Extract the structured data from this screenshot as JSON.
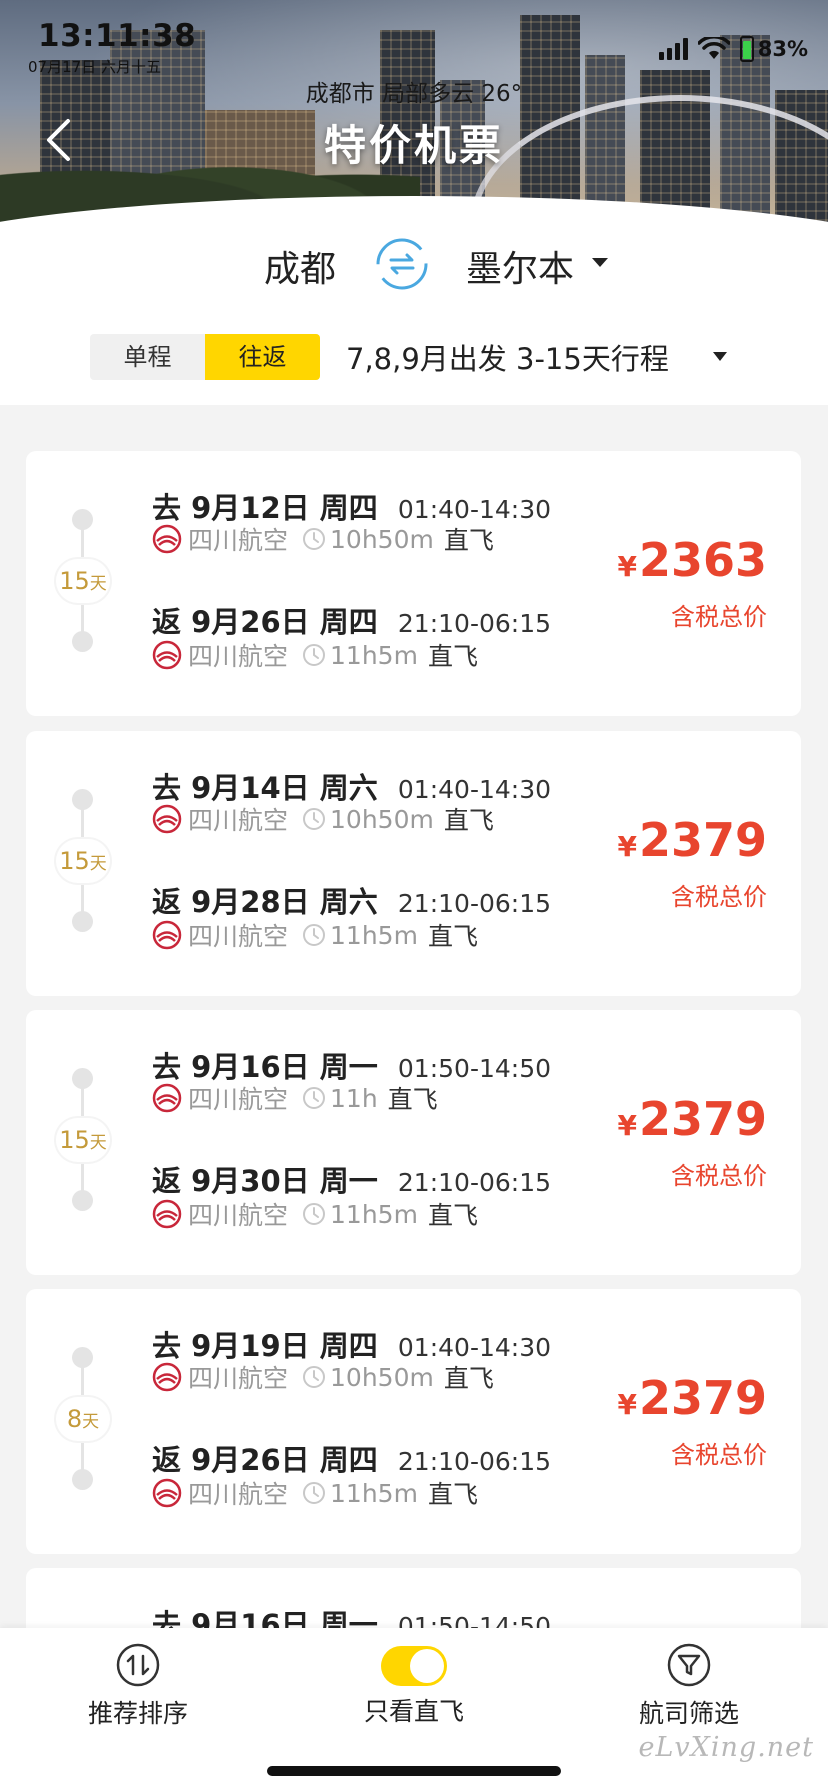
{
  "status_bar": {
    "time": "13:11:38",
    "date": "07月17日 六月十五",
    "battery": "83%"
  },
  "header": {
    "weather": "成都市 局部多云 26°",
    "title": "特价机票"
  },
  "route": {
    "from": "成都",
    "to": "墨尔本"
  },
  "filters": {
    "trip_types": [
      "单程",
      "往返"
    ],
    "active_trip_type": "往返",
    "date_range": "7,8,9月出发 3-15天行程"
  },
  "cards": [
    {
      "days": "15",
      "days_unit": "天",
      "outbound": {
        "dir": "去",
        "date": "9月12日",
        "weekday": "周四",
        "times": "01:40-14:30",
        "airline": "四川航空",
        "duration": "10h50m",
        "type": "直飞"
      },
      "return": {
        "dir": "返",
        "date": "9月26日",
        "weekday": "周四",
        "times": "21:10-06:15",
        "airline": "四川航空",
        "duration": "11h5m",
        "type": "直飞"
      },
      "currency": "¥",
      "price": "2363",
      "price_note": "含税总价"
    },
    {
      "days": "15",
      "days_unit": "天",
      "outbound": {
        "dir": "去",
        "date": "9月14日",
        "weekday": "周六",
        "times": "01:40-14:30",
        "airline": "四川航空",
        "duration": "10h50m",
        "type": "直飞"
      },
      "return": {
        "dir": "返",
        "date": "9月28日",
        "weekday": "周六",
        "times": "21:10-06:15",
        "airline": "四川航空",
        "duration": "11h5m",
        "type": "直飞"
      },
      "currency": "¥",
      "price": "2379",
      "price_note": "含税总价"
    },
    {
      "days": "15",
      "days_unit": "天",
      "outbound": {
        "dir": "去",
        "date": "9月16日",
        "weekday": "周一",
        "times": "01:50-14:50",
        "airline": "四川航空",
        "duration": "11h",
        "type": "直飞"
      },
      "return": {
        "dir": "返",
        "date": "9月30日",
        "weekday": "周一",
        "times": "21:10-06:15",
        "airline": "四川航空",
        "duration": "11h5m",
        "type": "直飞"
      },
      "currency": "¥",
      "price": "2379",
      "price_note": "含税总价"
    },
    {
      "days": "8",
      "days_unit": "天",
      "outbound": {
        "dir": "去",
        "date": "9月19日",
        "weekday": "周四",
        "times": "01:40-14:30",
        "airline": "四川航空",
        "duration": "10h50m",
        "type": "直飞"
      },
      "return": {
        "dir": "返",
        "date": "9月26日",
        "weekday": "周四",
        "times": "21:10-06:15",
        "airline": "四川航空",
        "duration": "11h5m",
        "type": "直飞"
      },
      "currency": "¥",
      "price": "2379",
      "price_note": "含税总价"
    }
  ],
  "partial_card": {
    "dir": "去",
    "date": "9月16日",
    "weekday": "周一",
    "times": "01:50-14:50"
  },
  "bottom_bar": {
    "sort_label": "推荐排序",
    "direct_only_label": "只看直飞",
    "direct_only_on": true,
    "airline_filter_label": "航司筛选"
  },
  "watermark": "eLvXing.net",
  "colors": {
    "accent_yellow": "#ffd600",
    "price_red": "#e8452e",
    "days_gold": "#c49a3a"
  },
  "icons": {
    "back": "chevron-left-icon",
    "swap": "swap-arrows-icon",
    "airline": "sichuan-airlines-logo-icon",
    "clock": "clock-icon",
    "sort": "sort-arrows-icon",
    "filter": "funnel-icon"
  }
}
